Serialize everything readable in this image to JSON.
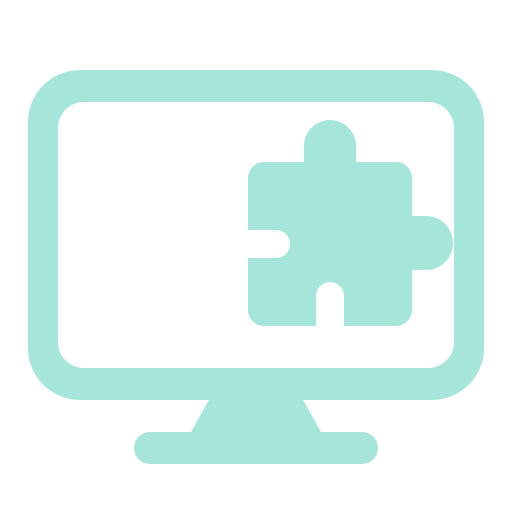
{
  "icon": {
    "name": "monitor-with-puzzle-piece-icon",
    "parts": [
      "monitor-icon",
      "monitor-stand-icon",
      "puzzle-piece-icon"
    ],
    "colors": {
      "stroke_fill": "#A6E5DA",
      "background": "#FFFFFF"
    }
  }
}
